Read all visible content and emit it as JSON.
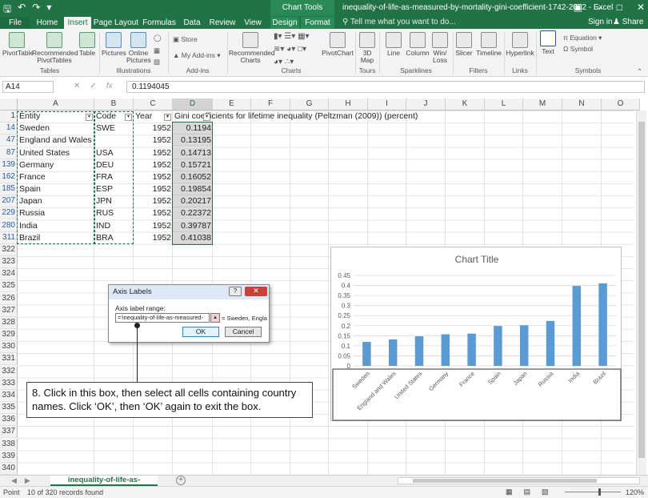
{
  "window": {
    "title": "inequality-of-life-as-measured-by-mortality-gini-coefficient-1742-2002 - Excel",
    "context_tab_header": "Chart Tools"
  },
  "ribbon_tabs": [
    "File",
    "Home",
    "Insert",
    "Page Layout",
    "Formulas",
    "Data",
    "Review",
    "View",
    "Design",
    "Format"
  ],
  "active_tab": "Insert",
  "tell_me": "Tell me what you want to do...",
  "sign_in": "Sign in",
  "share": "Share",
  "ribbon": {
    "groups": {
      "tables": "Tables",
      "illustrations": "Illustrations",
      "addins": "Add-ins",
      "charts": "Charts",
      "tours": "Tours",
      "sparklines": "Sparklines",
      "filters": "Filters",
      "links": "Links",
      "symbols": "Symbols"
    },
    "buttons": {
      "pivottable": "PivotTable",
      "recommended_pivottables": "Recommended PivotTables",
      "table": "Table",
      "pictures": "Pictures",
      "online_pictures": "Online Pictures",
      "store": "Store",
      "my_addins": "My Add-ins",
      "recommended_charts": "Recommended Charts",
      "pivotchart": "PivotChart",
      "map3d": "3D Map",
      "line": "Line",
      "column": "Column",
      "winloss": "Win/ Loss",
      "slicer": "Slicer",
      "timeline": "Timeline",
      "hyperlink": "Hyperlink",
      "text": "Text",
      "equation": "Equation",
      "symbol": "Symbol"
    }
  },
  "formula_bar": {
    "name_box": "A14",
    "value": "0.1194045"
  },
  "columns": [
    "A",
    "B",
    "C",
    "D",
    "E",
    "F",
    "G",
    "H",
    "I",
    "J",
    "K",
    "L",
    "M",
    "N",
    "O"
  ],
  "header_row": {
    "row": "1",
    "entity": "Entity",
    "code": "Code",
    "year": "Year",
    "gini": "Gini coefficients for lifetime inequality (Peltzman (2009)) (percent)"
  },
  "rows": [
    {
      "row": "14",
      "entity": "Sweden",
      "code": "SWE",
      "year": "1952",
      "value": "0.1194"
    },
    {
      "row": "47",
      "entity": "England and Wales",
      "code": "",
      "year": "1952",
      "value": "0.13195"
    },
    {
      "row": "87",
      "entity": "United States",
      "code": "USA",
      "year": "1952",
      "value": "0.14713"
    },
    {
      "row": "139",
      "entity": "Germany",
      "code": "DEU",
      "year": "1952",
      "value": "0.15721"
    },
    {
      "row": "162",
      "entity": "France",
      "code": "FRA",
      "year": "1952",
      "value": "0.16052"
    },
    {
      "row": "185",
      "entity": "Spain",
      "code": "ESP",
      "year": "1952",
      "value": "0.19854"
    },
    {
      "row": "207",
      "entity": "Japan",
      "code": "JPN",
      "year": "1952",
      "value": "0.20217"
    },
    {
      "row": "229",
      "entity": "Russia",
      "code": "RUS",
      "year": "1952",
      "value": "0.22372"
    },
    {
      "row": "280",
      "entity": "India",
      "code": "IND",
      "year": "1952",
      "value": "0.39787"
    },
    {
      "row": "311",
      "entity": "Brazil",
      "code": "BRA",
      "year": "1952",
      "value": "0.41038"
    }
  ],
  "empty_rows": [
    "322",
    "323",
    "324",
    "325",
    "326",
    "327",
    "328",
    "329",
    "330",
    "331",
    "332",
    "333",
    "334",
    "335",
    "336",
    "337",
    "338",
    "339",
    "340"
  ],
  "chart_data": {
    "type": "bar",
    "title": "Chart Title",
    "categories": [
      "Sweden",
      "England and Wales",
      "United States",
      "Germany",
      "France",
      "Spain",
      "Japan",
      "Russia",
      "India",
      "Brazil"
    ],
    "values": [
      0.1194,
      0.13195,
      0.14713,
      0.15721,
      0.16052,
      0.19854,
      0.20217,
      0.22372,
      0.39787,
      0.41038
    ],
    "ylim": [
      0,
      0.45
    ],
    "yticks": [
      "0",
      "0.05",
      "0.1",
      "0.15",
      "0.2",
      "0.25",
      "0.3",
      "0.35",
      "0.4",
      "0.45"
    ],
    "grid": true,
    "bar_color": "#5b9bd5"
  },
  "dialog": {
    "title": "Axis Labels",
    "label": "Axis label range:",
    "input_value": "='inequality-of-life-as-measured-",
    "preview": "= Sweden, Engla",
    "ok": "OK",
    "cancel": "Cancel"
  },
  "callout": {
    "text": "8. Click in this box, then select all cells containing country names. Click ‘OK’, then ‘OK’ again to exit the box."
  },
  "sheet_tab": "inequality-of-life-as-measured-",
  "status": {
    "ready": "Point",
    "records": "10 of 320 records found",
    "zoom": "120%"
  },
  "colors": {
    "excel_green": "#217346",
    "bar_blue": "#5b9bd5",
    "dialog_close_red": "#c7423a"
  }
}
